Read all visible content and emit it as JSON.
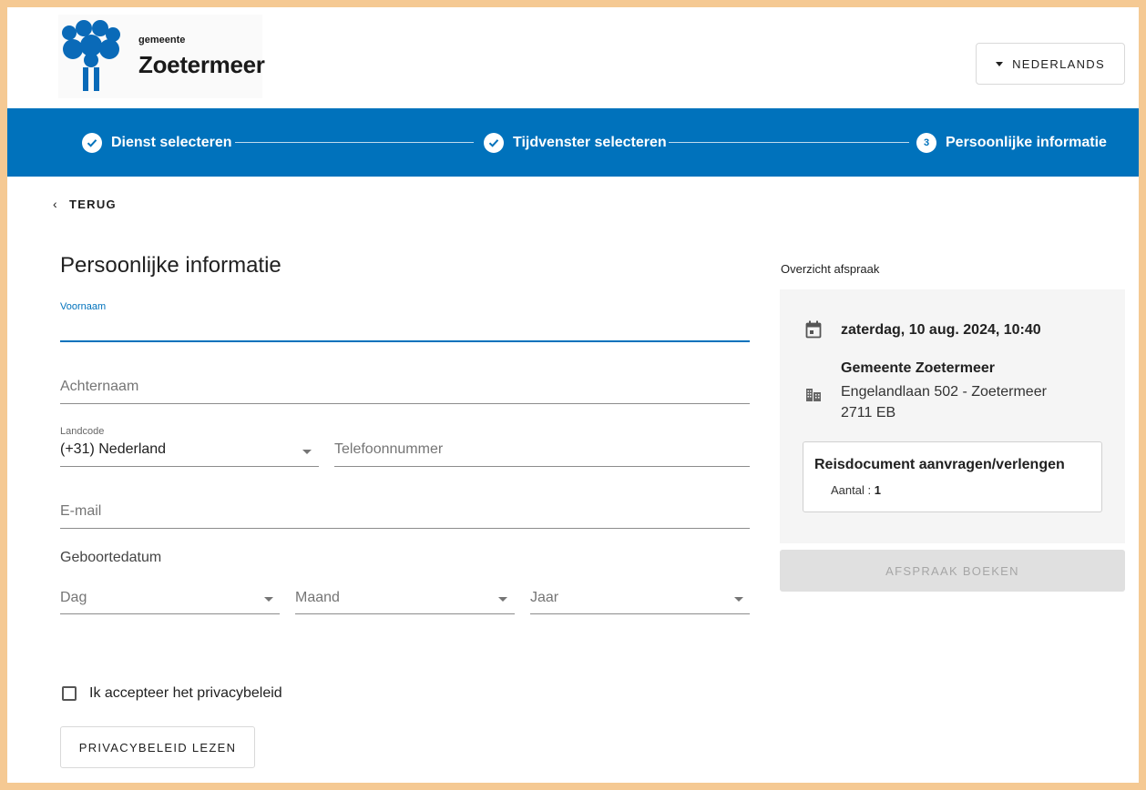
{
  "header": {
    "logo_small": "gemeente",
    "logo_big": "Zoetermeer",
    "language_button": "NEDERLANDS"
  },
  "stepper": {
    "steps": [
      {
        "label": "Dienst selecteren",
        "state": "completed"
      },
      {
        "label": "Tijdvenster selecteren",
        "state": "completed"
      },
      {
        "label": "Persoonlijke informatie",
        "state": "active",
        "number": "3"
      }
    ]
  },
  "back_label": "TERUG",
  "form": {
    "title": "Persoonlijke informatie",
    "first_name_label": "Voornaam",
    "first_name_value": "",
    "last_name_placeholder": "Achternaam",
    "country_code_label": "Landcode",
    "country_code_value": "(+31) Nederland",
    "phone_placeholder": "Telefoonnummer",
    "email_placeholder": "E-mail",
    "birthdate_label": "Geboortedatum",
    "day_placeholder": "Dag",
    "month_placeholder": "Maand",
    "year_placeholder": "Jaar",
    "privacy_checkbox_label": "Ik accepteer het privacybeleid",
    "privacy_checked": false,
    "privacy_button": "PRIVACYBELEID LEZEN"
  },
  "summary": {
    "heading": "Overzicht afspraak",
    "datetime": "zaterdag, 10 aug. 2024, 10:40",
    "location_name": "Gemeente Zoetermeer",
    "location_address": "Engelandlaan 502 - Zoetermeer",
    "location_zip": "2711 EB",
    "service_name": "Reisdocument aanvragen/verlengen",
    "quantity_label": "Aantal : ",
    "quantity_value": "1",
    "book_button": "AFSPRAAK BOEKEN",
    "book_button_enabled": false
  },
  "colors": {
    "brand_blue": "#0072bc",
    "page_border": "#f5c993",
    "disabled_bg": "#e0e0e0",
    "disabled_text": "#a6a6a6"
  }
}
